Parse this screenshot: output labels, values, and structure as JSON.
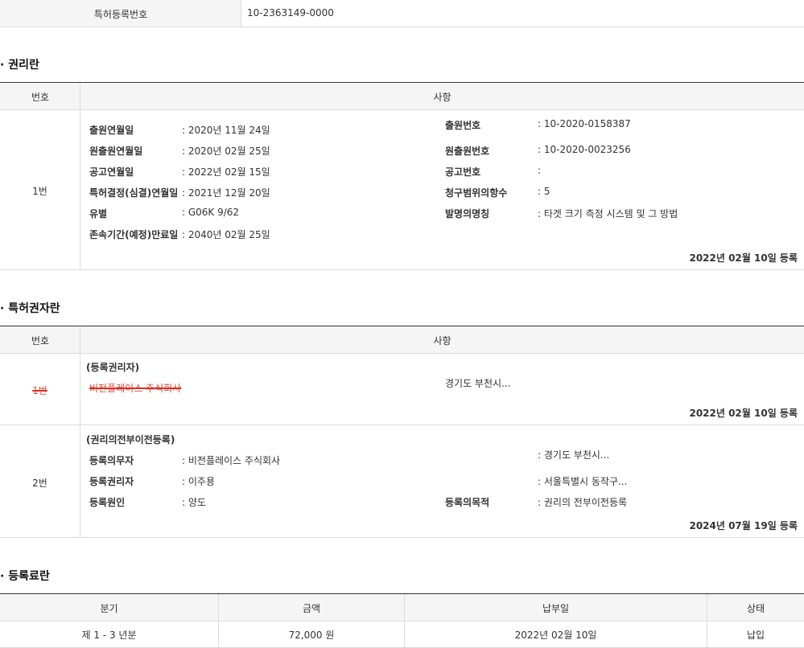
{
  "top": {
    "label": "특허등록번호",
    "value": "10-2363149-0000"
  },
  "rights": {
    "title": "· 권리란",
    "col_number": "번호",
    "col_item": "사항",
    "row": {
      "number": "1번",
      "left": [
        {
          "label": "출원연월일",
          "value": ": 2020년 11월 24일"
        },
        {
          "label": "원출원연월일",
          "value": ": 2020년 02월 25일"
        },
        {
          "label": "공고연월일",
          "value": ": 2022년 02월 15일"
        },
        {
          "label": "특허결정(심결)연월일",
          "value": ": 2021년 12월 20일"
        },
        {
          "label": "유별",
          "value": ": G06K 9/62"
        },
        {
          "label": "존속기간(예정)만료일",
          "value": ": 2040년 02월 25일"
        }
      ],
      "right": [
        {
          "label": "출원번호",
          "value": ": 10-2020-0158387"
        },
        {
          "label": "원출원번호",
          "value": ": 10-2020-0023256"
        },
        {
          "label": "공고번호",
          "value": ":"
        },
        {
          "label": "청구범위의항수",
          "value": ": 5"
        },
        {
          "label": "발명의명칭",
          "value": ": 타겟 크기 측정 시스템 및 그 방법"
        }
      ],
      "reg_date": "2022년 02월 10일 등록"
    }
  },
  "holders": {
    "title": "· 특허권자란",
    "col_number": "번호",
    "col_item": "사항",
    "row1": {
      "number": "1번",
      "heading": "(등록권리자)",
      "name": "비전플레이스 주식회사",
      "address": "경기도 부천시...",
      "reg_date": "2022년 02월 10일 등록"
    },
    "row2": {
      "number": "2번",
      "heading": "(권리의전부이전등록)",
      "obligor_label": "등록의무자",
      "obligor_value": ": 비전플레이스 주식회사",
      "obligor_address": ": 경기도 부천시...",
      "holder_label": "등록권리자",
      "holder_value": ": 이주용",
      "holder_address": ": 서울특별시 동작구...",
      "cause_label": "등록원인",
      "cause_value": ": 양도",
      "purpose_label": "등록의목적",
      "purpose_value": ": 권리의 전부이전등록",
      "reg_date": "2024년 07월 19일 등록"
    }
  },
  "fees": {
    "title": "· 등록료란",
    "headers": [
      "분기",
      "금액",
      "납부일",
      "상태"
    ],
    "row": [
      "제 1 - 3 년분",
      "72,000 원",
      "2022년 02월 10일",
      "납입"
    ]
  }
}
